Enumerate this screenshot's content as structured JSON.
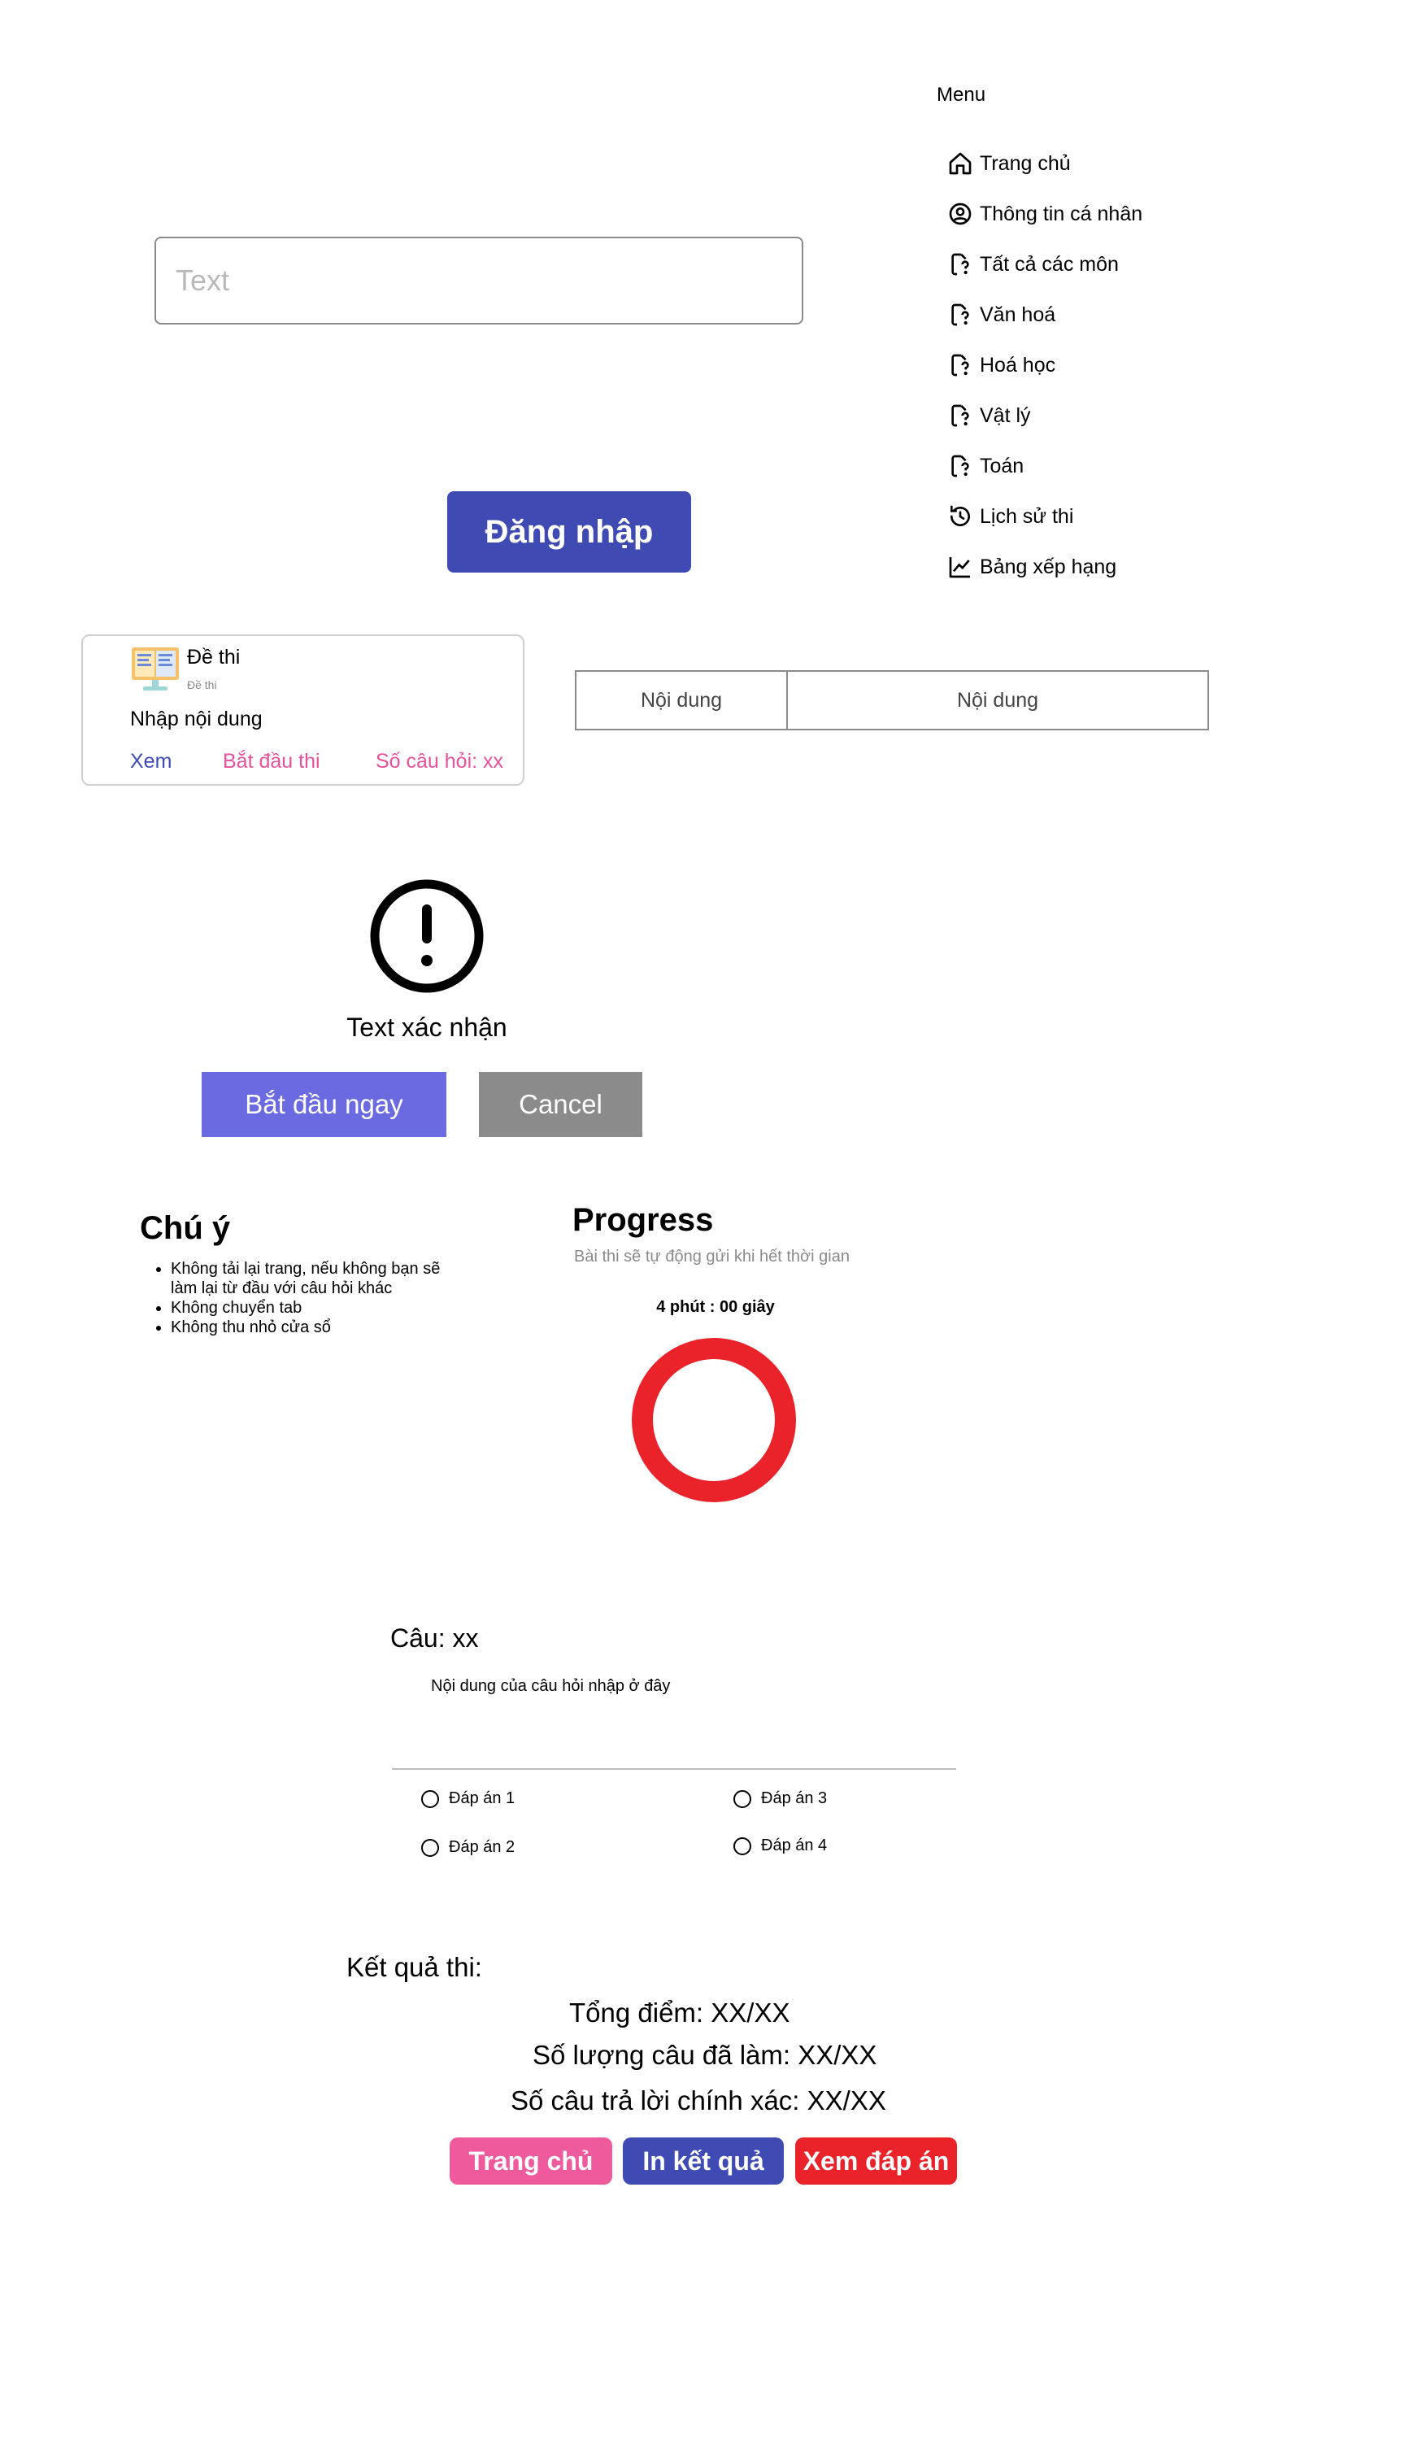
{
  "menu": {
    "title": "Menu",
    "items": [
      {
        "label": "Trang chủ",
        "icon": "home-icon"
      },
      {
        "label": "Thông tin cá nhân",
        "icon": "user-circle-icon"
      },
      {
        "label": "Tất cả các môn",
        "icon": "file-question-icon"
      },
      {
        "label": "Văn hoá",
        "icon": "file-question-icon"
      },
      {
        "label": "Hoá học",
        "icon": "file-question-icon"
      },
      {
        "label": "Vật lý",
        "icon": "file-question-icon"
      },
      {
        "label": "Toán",
        "icon": "file-question-icon"
      },
      {
        "label": "Lịch sử thi",
        "icon": "history-icon"
      },
      {
        "label": "Bảng xếp hạng",
        "icon": "chart-line-icon"
      }
    ]
  },
  "login": {
    "input_placeholder": "Text",
    "button_label": "Đăng nhập"
  },
  "exam_card": {
    "title": "Đề thi",
    "subtitle": "Đề thi",
    "content": "Nhập nội dung",
    "view_link": "Xem",
    "start_link": "Bắt đầu thi",
    "count_link": "Số câu hỏi: xx"
  },
  "table": {
    "cells": [
      "Nội dung",
      "Nội dung"
    ]
  },
  "confirm": {
    "text": "Text xác nhận",
    "start_button": "Bắt đầu ngay",
    "cancel_button": "Cancel"
  },
  "note": {
    "title": "Chú ý",
    "items": [
      "Không tải lại trang, nếu không bạn sẽ làm lại từ đầu với câu hỏi khác",
      "Không chuyển tab",
      "Không thu nhỏ cửa sổ"
    ]
  },
  "progress": {
    "title": "Progress",
    "description": "Bài thi sẽ tự động gửi khi hết thời gian",
    "time": "4 phút : 00 giây",
    "ring_color": "#ea2229"
  },
  "question": {
    "title": "Câu: xx",
    "content": "Nội dung của câu hỏi nhập ở đây",
    "answers": [
      "Đáp án 1",
      "Đáp án 2",
      "Đáp án 3",
      "Đáp án 4"
    ]
  },
  "results": {
    "title": "Kết quả thi:",
    "total": "Tổng điểm: XX/XX",
    "answered": "Số lượng câu đã làm: XX/XX",
    "correct": "Số câu trả lời chính xác: XX/XX",
    "home_button": "Trang chủ",
    "print_button": "In kết quả",
    "answers_button": "Xem đáp án"
  },
  "colors": {
    "primary": "#3f4bb3",
    "pink": "#e7529a",
    "red": "#ea2229",
    "purple": "#6b6ae0",
    "gray": "#8c8b8b"
  }
}
